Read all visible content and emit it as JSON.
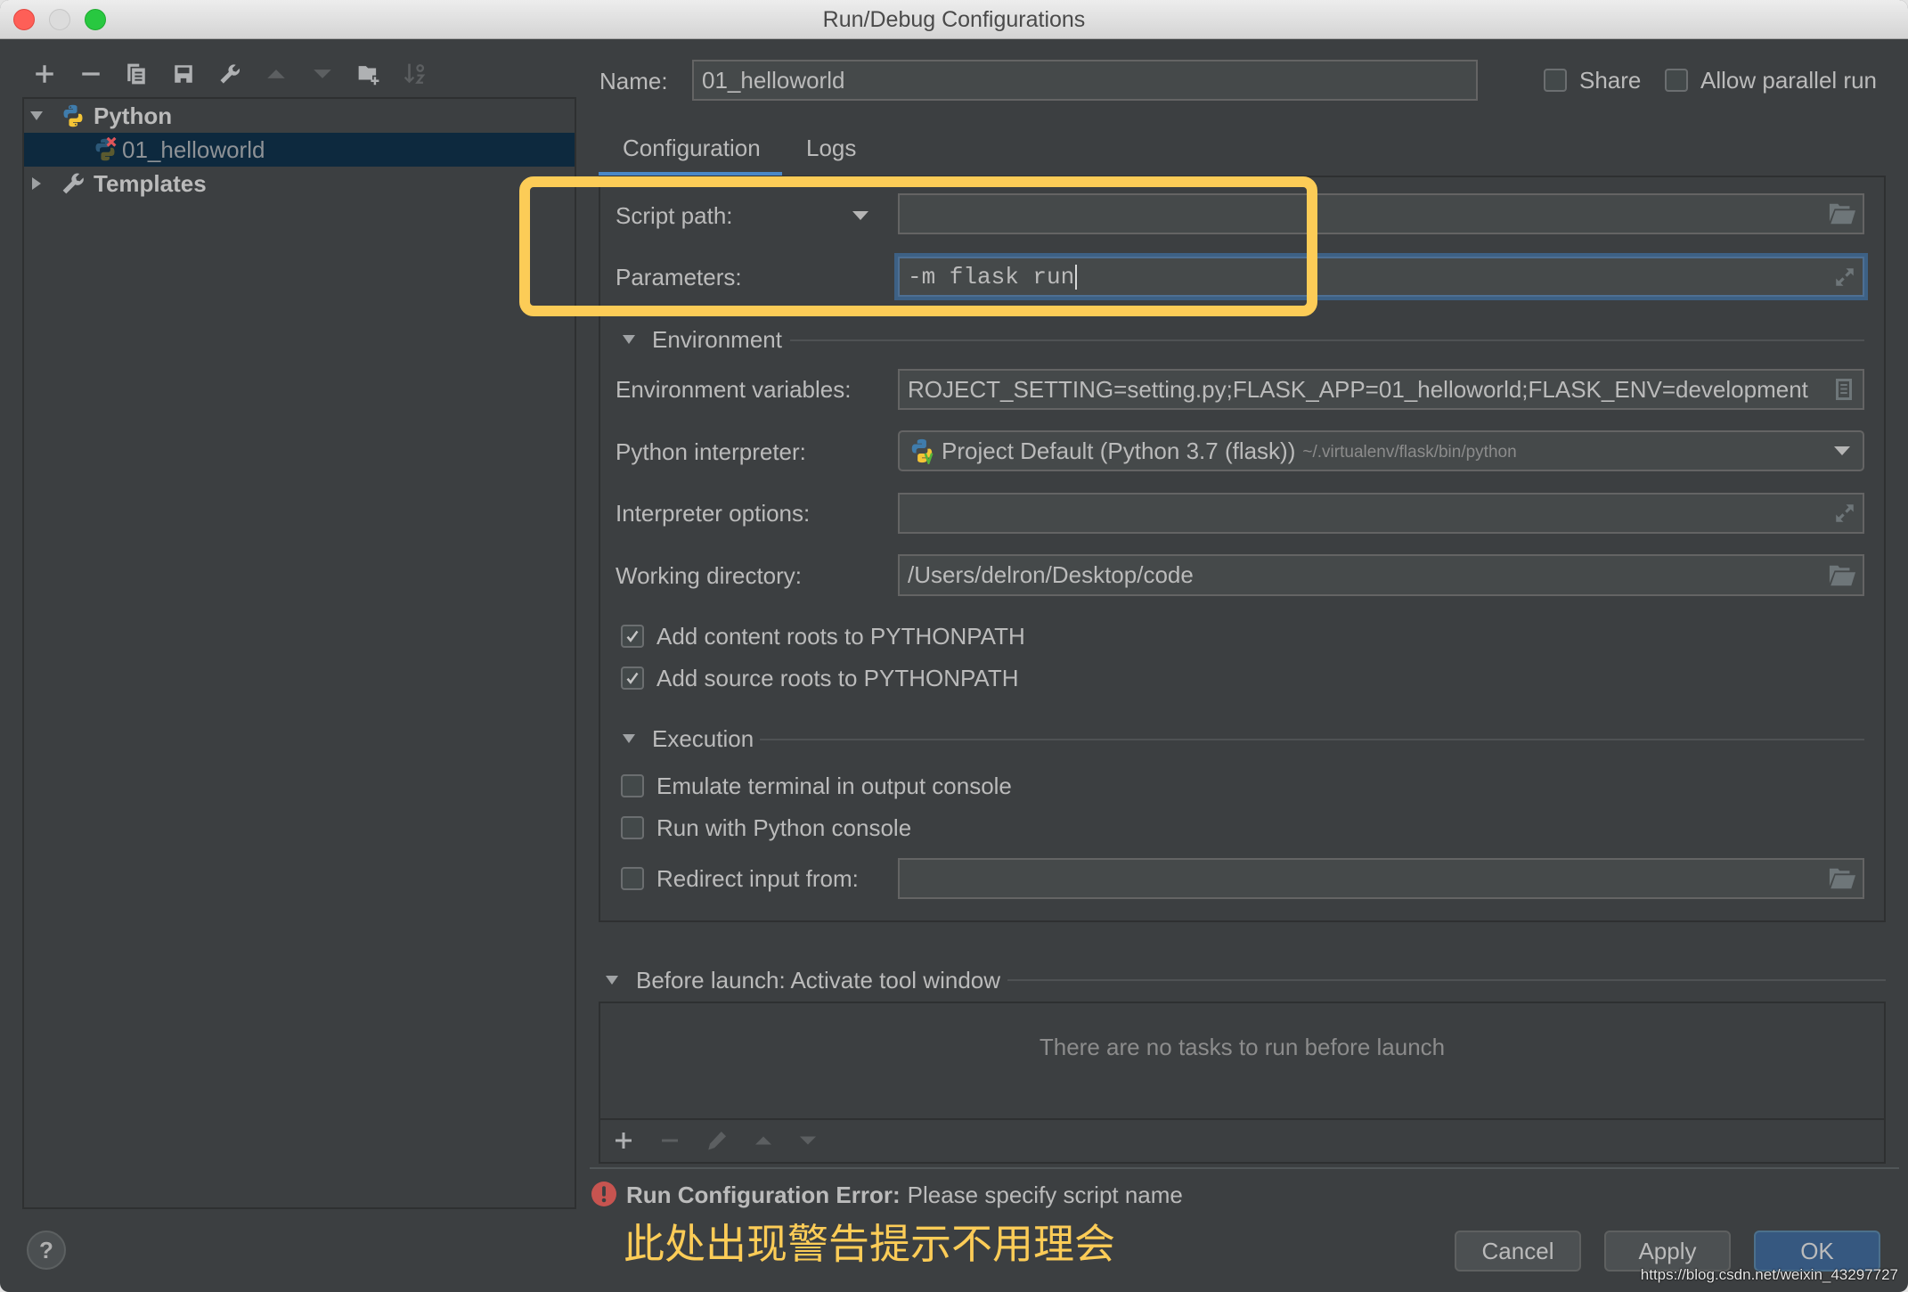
{
  "colors": {
    "background": "#3c3f41",
    "text": "#bbbbbb",
    "selection": "#0d293e",
    "accent": "#4a88c7",
    "focus_ring": "#3d6185",
    "highlight": "#fccc57",
    "error": "#c75450",
    "ok_button": "#365880"
  },
  "window": {
    "title": "Run/Debug Configurations"
  },
  "left_toolbar": [
    {
      "id": "add",
      "icon": "plus-icon",
      "disabled": false
    },
    {
      "id": "remove",
      "icon": "minus-icon",
      "disabled": false
    },
    {
      "id": "copy",
      "icon": "copy-icon",
      "disabled": false
    },
    {
      "id": "save",
      "icon": "save-icon",
      "disabled": false
    },
    {
      "id": "edit-templates",
      "icon": "wrench-icon",
      "disabled": false
    },
    {
      "id": "move-up",
      "icon": "arrow-up-icon",
      "disabled": true
    },
    {
      "id": "move-down",
      "icon": "arrow-down-icon",
      "disabled": true
    },
    {
      "id": "new-folder",
      "icon": "folder-plus-icon",
      "disabled": false
    },
    {
      "id": "sort",
      "icon": "sort-alpha-icon",
      "disabled": true
    }
  ],
  "tree": {
    "items": [
      {
        "label": "Python",
        "icon": "python-icon",
        "expanded": true,
        "selected": false
      },
      {
        "label": "01_helloworld",
        "icon": "python-config-error-icon",
        "selected": true
      },
      {
        "label": "Templates",
        "icon": "wrench-icon",
        "expanded": false,
        "selected": false
      }
    ]
  },
  "header": {
    "name_label": "Name:",
    "name_value": "01_helloworld",
    "share_label": "Share",
    "share_checked": false,
    "allow_parallel_label": "Allow parallel run",
    "allow_parallel_checked": false
  },
  "tabs": [
    {
      "label": "Configuration",
      "active": true
    },
    {
      "label": "Logs",
      "active": false
    }
  ],
  "config": {
    "script_path": {
      "label": "Script path:",
      "value": ""
    },
    "parameters": {
      "label": "Parameters:",
      "value": "-m flask run"
    },
    "environment": {
      "section_label": "Environment",
      "env_vars": {
        "label": "Environment variables:",
        "value": "ROJECT_SETTING=setting.py;FLASK_APP=01_helloworld;FLASK_ENV=development"
      },
      "interpreter": {
        "label": "Python interpreter:",
        "value": "Project Default (Python 3.7 (flask))",
        "path": "~/.virtualenv/flask/bin/python"
      },
      "interpreter_options": {
        "label": "Interpreter options:",
        "value": ""
      },
      "working_directory": {
        "label": "Working directory:",
        "value": "/Users/delron/Desktop/code"
      },
      "checkboxes": [
        {
          "label": "Add content roots to PYTHONPATH",
          "checked": true
        },
        {
          "label": "Add source roots to PYTHONPATH",
          "checked": true
        }
      ]
    },
    "execution": {
      "section_label": "Execution",
      "checkboxes": [
        {
          "label": "Emulate terminal in output console",
          "checked": false
        },
        {
          "label": "Run with Python console",
          "checked": false
        }
      ],
      "redirect_input": {
        "label": "Redirect input from:",
        "checked": false,
        "value": ""
      }
    }
  },
  "before_launch": {
    "section_label": "Before launch: Activate tool window",
    "empty_text": "There are no tasks to run before launch",
    "toolbar": [
      {
        "id": "add",
        "icon": "plus-icon",
        "disabled": false
      },
      {
        "id": "remove",
        "icon": "minus-icon",
        "disabled": true
      },
      {
        "id": "edit",
        "icon": "pencil-icon",
        "disabled": true
      },
      {
        "id": "move-up",
        "icon": "arrow-up-icon",
        "disabled": true
      },
      {
        "id": "move-down",
        "icon": "arrow-down-icon",
        "disabled": true
      }
    ]
  },
  "status": {
    "error_title": "Run Configuration Error:",
    "error_message": "Please specify script name"
  },
  "annotation": "此处出现警告提示不用理会",
  "footer": {
    "help": "?",
    "cancel": "Cancel",
    "apply": "Apply",
    "ok": "OK"
  },
  "watermark": "https://blog.csdn.net/weixin_43297727"
}
